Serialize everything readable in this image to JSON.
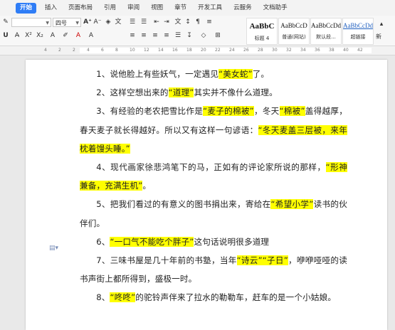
{
  "menu": {
    "tabs": [
      "开始",
      "插入",
      "页面布局",
      "引用",
      "审阅",
      "视图",
      "章节",
      "开发工具",
      "云服务",
      "文档助手"
    ]
  },
  "ribbon": {
    "font_name": "",
    "font_size": "四号",
    "styles": [
      {
        "sample": "AaBbC",
        "name": "标题 4"
      },
      {
        "sample": "AaBbCcD",
        "name": "普通(网站)"
      },
      {
        "sample": "AaBbCcDd",
        "name": "默认段..."
      },
      {
        "sample": "AaBbCcDd",
        "name": "超链接"
      }
    ],
    "new_style_label": "新"
  },
  "ruler": {
    "ticks": [
      "4",
      "2",
      "2",
      "4",
      "6",
      "8",
      "10",
      "12",
      "14",
      "16",
      "18",
      "20",
      "22",
      "24",
      "26",
      "28",
      "30",
      "32",
      "34",
      "36",
      "38",
      "40",
      "42"
    ]
  },
  "document": {
    "paragraphs": [
      [
        [
          "1、说他脸上有些妖气，一定遇见",
          false
        ],
        [
          "“美女蛇”",
          true
        ],
        [
          "了。",
          false
        ]
      ],
      [
        [
          "2、这样空想出来的",
          false
        ],
        [
          "“道理”",
          true
        ],
        [
          "其实并不像什么道理。",
          false
        ]
      ],
      [
        [
          "3、有经验的老农把雪比作是",
          false
        ],
        [
          "“麦子的棉被”",
          true
        ],
        [
          "，冬天",
          false
        ],
        [
          "“棉被”",
          true
        ],
        [
          "盖得越厚，春天麦子就长得越好。所以又有这样一句谚语：",
          false
        ],
        [
          "“冬天麦盖三层被，来年枕着馒头睡。”",
          true
        ]
      ],
      [
        [
          "4、现代画家徐悲鸿笔下的马，正如有的评论家所说的那样，",
          false
        ],
        [
          "“形神兼备，充满生机”",
          true
        ],
        [
          "。",
          false
        ]
      ],
      [
        [
          "5、把我们看过的有意义的图书捐出来，寄给在",
          false
        ],
        [
          "“希望小学”",
          true
        ],
        [
          "读书的伙伴们。",
          false
        ]
      ],
      [
        [
          "6、",
          false
        ],
        [
          "“一口气不能吃个胖子”",
          true
        ],
        [
          "这句话说明很多道理",
          false
        ]
      ],
      [
        [
          "7、三味书屋是几十年前的书塾，当年",
          false
        ],
        [
          "“诗云”",
          true
        ],
        [
          "“子日”",
          true
        ],
        [
          "，咿咿哑哑的读书声街上都所得到，盛极一时。",
          false
        ]
      ],
      [
        [
          "8、",
          false
        ],
        [
          "“咚咚”",
          true
        ],
        [
          "的驼铃声伴来了拉水的勒勒车，赶车的是一个小姑娘。",
          false
        ]
      ]
    ]
  }
}
